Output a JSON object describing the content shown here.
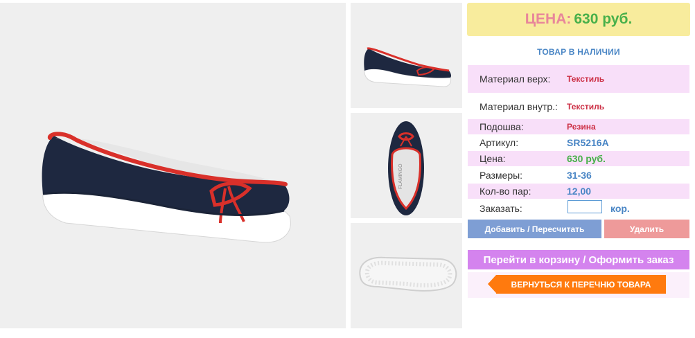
{
  "price_box": {
    "label": "ЦЕНА:",
    "value": "630 руб."
  },
  "stock_status": "ТОВАР В НАЛИЧИИ",
  "specs": {
    "material_top": {
      "label": "Материал верх:",
      "value": "Текстиль"
    },
    "material_inner": {
      "label": "Материал внутр.:",
      "value": "Текстиль"
    },
    "sole": {
      "label": "Подошва:",
      "value": "Резина"
    },
    "article": {
      "label": "Артикул:",
      "value": "SR5216A"
    },
    "price": {
      "label": "Цена:",
      "value": "630 руб."
    },
    "sizes": {
      "label": "Размеры:",
      "value": "31-36"
    },
    "pairs": {
      "label": "Кол-во пар:",
      "value": "12,00"
    },
    "order": {
      "label": "Заказать:",
      "input_value": "",
      "unit": "кор."
    }
  },
  "buttons": {
    "add": "Добавить / Пересчитать",
    "delete": "Удалить",
    "cart": "Перейти в корзину / Оформить заказ",
    "back": "ВЕРНУТЬСЯ К ПЕРЕЧНЮ ТОВАРА"
  },
  "brand_on_insole": "FLAMINGO",
  "colors": {
    "price_bg": "#f8ec9d",
    "price_label": "#e8869a",
    "price_value": "#48b04a",
    "accent_blue": "#4a86c5",
    "spec_red": "#cc2f45",
    "row_pink": "#f8dff9",
    "btn_add": "#7e9ed4",
    "btn_delete": "#ee9a9a",
    "btn_cart": "#d483ee",
    "btn_back": "#ff7a0e",
    "shoe_navy": "#1b2438",
    "shoe_red": "#d9302a"
  }
}
